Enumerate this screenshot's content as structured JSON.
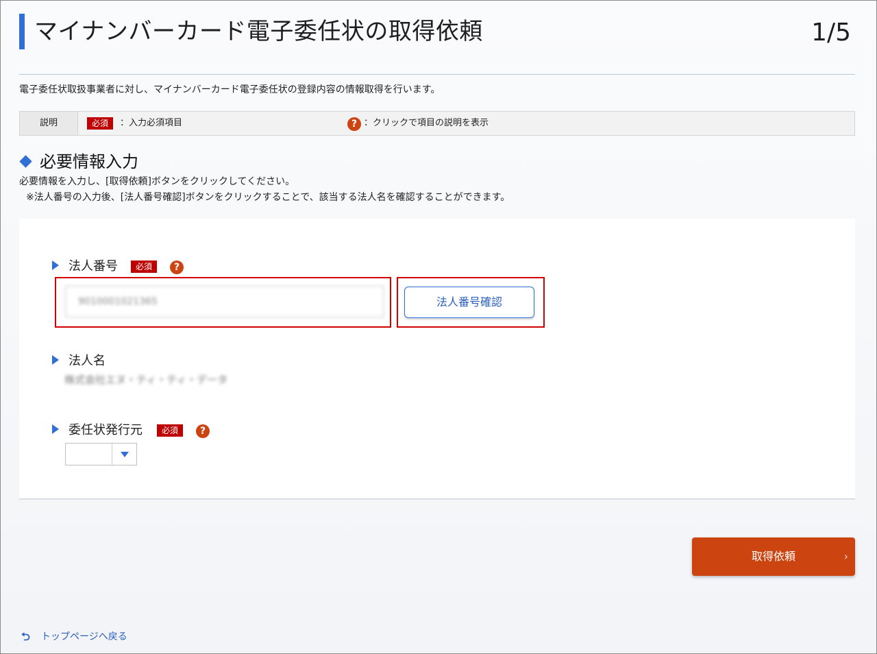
{
  "header": {
    "title": "マイナンバーカード電子委任状の取得依頼",
    "step": "1/5"
  },
  "intro": "電子委任状取扱事業者に対し、マイナンバーカード電子委任状の登録内容の情報取得を行います。",
  "legend": {
    "head": "説明",
    "required_badge": "必須",
    "required_text": "：入力必須項目",
    "help_icon_glyph": "?",
    "help_text": "：クリックで項目の説明を表示"
  },
  "section": {
    "title": "必要情報入力",
    "note1": "必要情報を入力し、[取得依頼]ボタンをクリックしてください。",
    "note2": "※法人番号の入力後、[法人番号確認]ボタンをクリックすることで、該当する法人名を確認することができます。"
  },
  "fields": {
    "corp_number": {
      "label": "法人番号",
      "required_badge": "必須",
      "help_glyph": "?",
      "value": "9010001021365",
      "check_button": "法人番号確認"
    },
    "corp_name": {
      "label": "法人名",
      "value": "株式会社エヌ・ティ・ティ・データ"
    },
    "issuer": {
      "label": "委任状発行元",
      "required_badge": "必須",
      "help_glyph": "?",
      "selected": ""
    }
  },
  "submit": {
    "label": "取得依頼",
    "chevron": "›"
  },
  "back_link": {
    "icon": "⮌",
    "label": "トップページへ戻る"
  },
  "colors": {
    "accent": "#2f6fd6",
    "required": "#c00000",
    "help": "#cc4411",
    "submit": "#cc4511",
    "highlight": "#d40000"
  }
}
